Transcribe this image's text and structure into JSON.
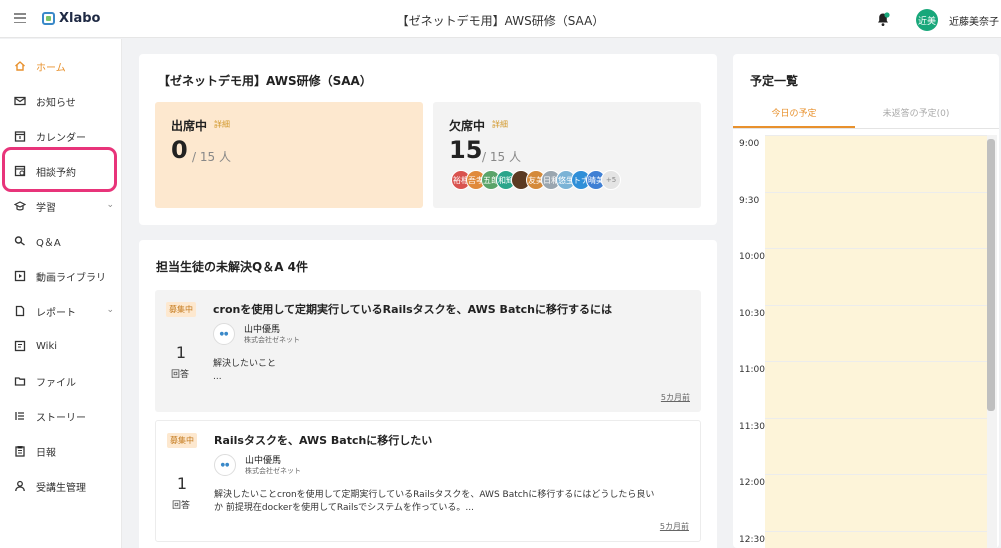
{
  "header": {
    "app_name": "Xlabo",
    "page_title": "【ゼネットデモ用】AWS研修（SAA）",
    "user_initials": "近美",
    "user_name": "近藤美奈子"
  },
  "sidebar": {
    "items": [
      {
        "label": "ホーム",
        "icon": "home-icon",
        "active": true
      },
      {
        "label": "お知らせ",
        "icon": "mail-icon"
      },
      {
        "label": "カレンダー",
        "icon": "calendar-icon"
      },
      {
        "label": "相談予約",
        "icon": "booking-icon"
      },
      {
        "label": "学習",
        "icon": "graduation-cap-icon",
        "expandable": true
      },
      {
        "label": "Q＆A",
        "icon": "qa-icon"
      },
      {
        "label": "動画ライブラリ",
        "icon": "video-icon"
      },
      {
        "label": "レポート",
        "icon": "document-icon",
        "expandable": true
      },
      {
        "label": "Wiki",
        "icon": "wiki-icon"
      },
      {
        "label": "ファイル",
        "icon": "folder-icon"
      },
      {
        "label": "ストーリー",
        "icon": "list-icon"
      },
      {
        "label": "日報",
        "icon": "clipboard-icon"
      },
      {
        "label": "受講生管理",
        "icon": "person-icon"
      }
    ]
  },
  "course": {
    "title": "【ゼネットデモ用】AWS研修（SAA）",
    "present": {
      "label": "出席中",
      "detail": "詳細",
      "count": "0",
      "total": "/ 15 人"
    },
    "absent": {
      "label": "欠席中",
      "detail": "詳細",
      "count": "15",
      "total": "/ 15 人",
      "avatars": [
        {
          "text": "裕相",
          "color": "#d9534f"
        },
        {
          "text": "吾孝",
          "color": "#e08a3c"
        },
        {
          "text": "五郎",
          "color": "#5aa469"
        },
        {
          "text": "和輝",
          "color": "#2aa58b"
        },
        {
          "text": "",
          "color": "#5b3a22"
        },
        {
          "text": "友美",
          "color": "#d48a3a"
        },
        {
          "text": "日和",
          "color": "#9aa6b0"
        },
        {
          "text": "悠生",
          "color": "#7bb3d6"
        },
        {
          "text": "トナ",
          "color": "#2f8fd8"
        },
        {
          "text": "晴美",
          "color": "#3f7fd4"
        }
      ],
      "more": "+5"
    }
  },
  "qa": {
    "heading": "担当生徒の未解決Q＆A 4件",
    "items": [
      {
        "badge": "募集中",
        "title": "cronを使用して定期実行しているRailsタスクを、AWS Batchに移行するには",
        "user": "山中優馬",
        "company": "株式会社ゼネット",
        "answers": "1",
        "answers_label": "回答",
        "body_line1": "解決したいこと",
        "body_line2": "...",
        "time": "5カ月前"
      },
      {
        "badge": "募集中",
        "title": "Railsタスクを、AWS Batchに移行したい",
        "user": "山中優馬",
        "company": "株式会社ゼネット",
        "answers": "1",
        "answers_label": "回答",
        "body_line1": "解決したいことcronを使用して定期実行しているRailsタスクを、AWS Batchに移行するにはどうしたら良い",
        "body_line2": "か 前提現在dockerを使用してRailsでシステムを作っている。...",
        "time": "5カ月前"
      }
    ]
  },
  "schedule": {
    "title": "予定一覧",
    "tab_today": "今日の予定",
    "tab_pending": "未返答の予定(0)",
    "times": [
      "9:00",
      "9:30",
      "10:00",
      "10:30",
      "11:00",
      "11:30",
      "12:00",
      "12:30"
    ]
  }
}
